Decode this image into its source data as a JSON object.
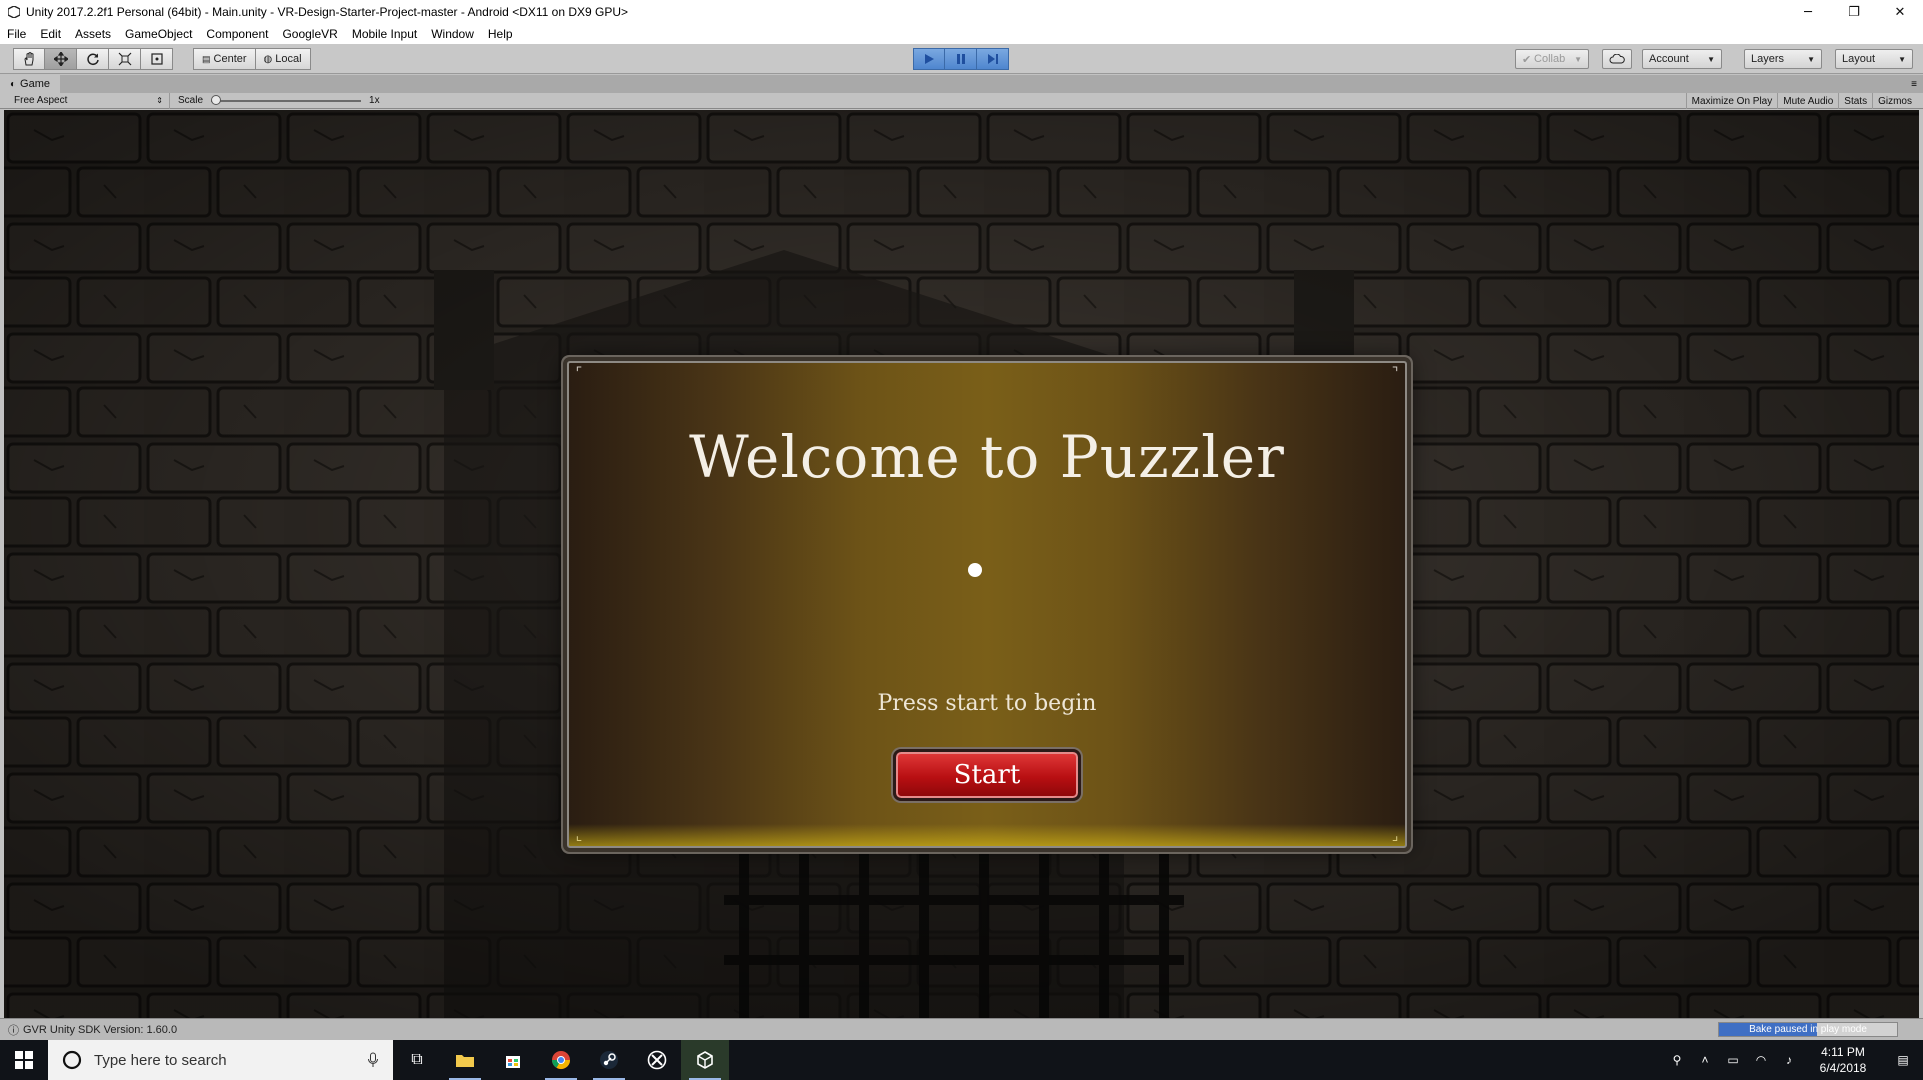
{
  "window": {
    "title": "Unity 2017.2.2f1 Personal (64bit) - Main.unity - VR-Design-Starter-Project-master - Android <DX11 on DX9 GPU>",
    "minimize": "─",
    "restore": "❐",
    "close": "✕"
  },
  "menu": [
    "File",
    "Edit",
    "Assets",
    "GameObject",
    "Component",
    "GoogleVR",
    "Mobile Input",
    "Window",
    "Help"
  ],
  "toolbar": {
    "pivot_center": "Center",
    "pivot_local": "Local",
    "collab": "Collab",
    "account": "Account",
    "layers": "Layers",
    "layout": "Layout"
  },
  "game_panel": {
    "tab_label": "Game",
    "aspect": "Free Aspect",
    "scale_label": "Scale",
    "scale_value": "1x",
    "maximize_on_play": "Maximize On Play",
    "mute_audio": "Mute Audio",
    "stats": "Stats",
    "gizmos": "Gizmos"
  },
  "game": {
    "title": "Welcome to Puzzler",
    "subtitle": "Press start to begin",
    "start_label": "Start"
  },
  "status": {
    "message": "GVR Unity SDK Version: 1.60.0",
    "bake_label": "Bake paused in play mode",
    "bake_progress": 0.55
  },
  "taskbar": {
    "search_placeholder": "Type here to search",
    "time": "4:11 PM",
    "date": "6/4/2018"
  },
  "colors": {
    "play_active": "#4f86cf",
    "start_button": "#c4171a",
    "bake_fill": "#3f6fc4"
  }
}
